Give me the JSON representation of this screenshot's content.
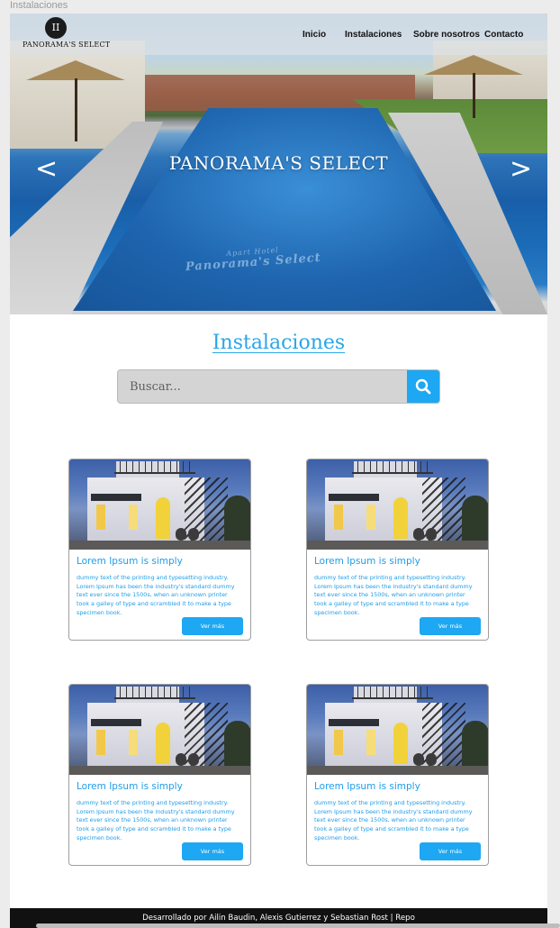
{
  "frame": {
    "label": "Instalaciones"
  },
  "navbar": {
    "logo_mark": "II",
    "logo_name": "PANORAMA'S SELECT",
    "links": [
      {
        "label": "Inicio"
      },
      {
        "label": "Instalaciones"
      },
      {
        "label": "Sobre nosotros"
      },
      {
        "label": "Contacto"
      }
    ]
  },
  "hero": {
    "title": "PANORAMA'S SELECT",
    "prev_arrow": "<",
    "next_arrow": ">",
    "watermark_top": "Apart Hotel",
    "watermark_main": "Panorama's Select"
  },
  "section": {
    "title": "Instalaciones",
    "search_placeholder": "Buscar..."
  },
  "cards": [
    {
      "title": "Lorem Ipsum is simply",
      "text": "dummy text of the printing and typesetting industry. Lorem Ipsum has been the industry's standard dummy text ever since the 1500s, when an unknown printer took a galley of type and scrambled it to make a type specimen book.",
      "button": "Ver más"
    },
    {
      "title": "Lorem Ipsum is simply",
      "text": "dummy text of the printing and typesetting industry. Lorem Ipsum has been the industry's standard dummy text ever since the 1500s, when an unknown printer took a galley of type and scrambled it to make a type specimen book.",
      "button": "Ver más"
    },
    {
      "title": "Lorem Ipsum is simply",
      "text": "dummy text of the printing and typesetting industry. Lorem Ipsum has been the industry's standard dummy text ever since the 1500s, when an unknown printer took a galley of type and scrambled it to make a type specimen book.",
      "button": "Ver más"
    },
    {
      "title": "Lorem Ipsum is simply",
      "text": "dummy text of the printing and typesetting industry. Lorem Ipsum has been the industry's standard dummy text ever since the 1500s, when an unknown printer took a galley of type and scrambled it to make a type specimen book.",
      "button": "Ver más"
    }
  ],
  "footer": {
    "text": "Desarrollado por Ailin Baudin, Alexis Gutierrez y Sebastian Rost | Repo"
  },
  "colors": {
    "accent": "#1ea7f2",
    "title_blue": "#29a6e9",
    "footer_bg": "#111111"
  },
  "icons": {
    "search": "search-icon",
    "prev": "chevron-left-icon",
    "next": "chevron-right-icon"
  }
}
